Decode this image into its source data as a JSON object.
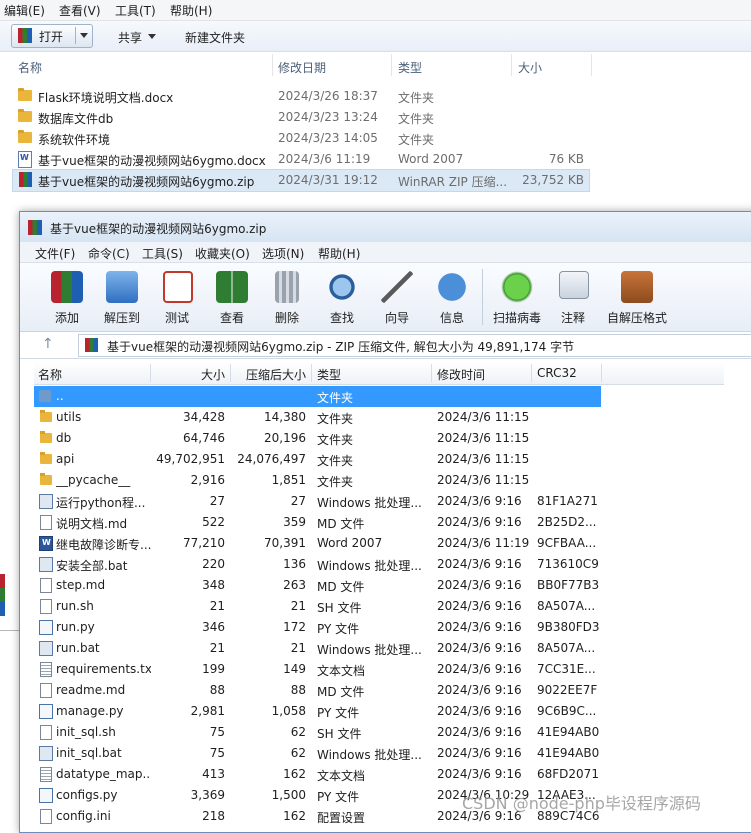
{
  "explorer": {
    "menu": [
      "编辑(E)",
      "查看(V)",
      "工具(T)",
      "帮助(H)"
    ],
    "toolbar": {
      "open": "打开",
      "share": "共享",
      "new_folder": "新建文件夹"
    },
    "columns": {
      "name": "名称",
      "date": "修改日期",
      "type": "类型",
      "size": "大小"
    },
    "files": [
      {
        "icon": "folder-icon",
        "name": "Flask环境说明文档.docx",
        "date": "2024/3/26 18:37",
        "type": "文件夹",
        "size": ""
      },
      {
        "icon": "folder-icon",
        "name": "数据库文件db",
        "date": "2024/3/23 13:24",
        "type": "文件夹",
        "size": ""
      },
      {
        "icon": "folder-icon",
        "name": "系统软件环境",
        "date": "2024/3/23 14:05",
        "type": "文件夹",
        "size": ""
      },
      {
        "icon": "word-doc-icon",
        "name": "基于vue框架的动漫视频网站6ygmo.docx",
        "date": "2024/3/6 11:19",
        "type": "Word 2007",
        "size": "76 KB"
      },
      {
        "icon": "winrar-icon",
        "name": "基于vue框架的动漫视频网站6ygmo.zip",
        "date": "2024/3/31 19:12",
        "type": "WinRAR ZIP 压缩...",
        "size": "23,752 KB",
        "selected": true
      }
    ]
  },
  "winrar": {
    "title": "基于vue框架的动漫视频网站6ygmo.zip",
    "menu": [
      "文件(F)",
      "命令(C)",
      "工具(S)",
      "收藏夹(O)",
      "选项(N)",
      "帮助(H)"
    ],
    "tools": [
      {
        "label": "添加",
        "icon": "add-icon"
      },
      {
        "label": "解压到",
        "icon": "extract-to-icon"
      },
      {
        "label": "测试",
        "icon": "test-icon"
      },
      {
        "label": "查看",
        "icon": "view-icon"
      },
      {
        "label": "删除",
        "icon": "delete-icon"
      },
      {
        "label": "查找",
        "icon": "find-icon"
      },
      {
        "label": "向导",
        "icon": "wizard-icon"
      },
      {
        "label": "信息",
        "icon": "info-icon"
      },
      {
        "label": "扫描病毒",
        "icon": "virus-scan-icon"
      },
      {
        "label": "注释",
        "icon": "comment-icon"
      },
      {
        "label": "自解压格式",
        "icon": "sfx-icon"
      }
    ],
    "path": "基于vue框架的动漫视频网站6ygmo.zip - ZIP 压缩文件, 解包大小为 49,891,174 字节",
    "columns": {
      "name": "名称",
      "size": "大小",
      "packed": "压缩后大小",
      "type": "类型",
      "modified": "修改时间",
      "crc": "CRC32"
    },
    "rows": [
      {
        "icon": "up",
        "name": "..",
        "size": "",
        "packed": "",
        "type": "文件夹",
        "modified": "",
        "crc": ""
      },
      {
        "icon": "folder",
        "name": "utils",
        "size": "34,428",
        "packed": "14,380",
        "type": "文件夹",
        "modified": "2024/3/6 11:15",
        "crc": ""
      },
      {
        "icon": "folder",
        "name": "db",
        "size": "64,746",
        "packed": "20,196",
        "type": "文件夹",
        "modified": "2024/3/6 11:15",
        "crc": ""
      },
      {
        "icon": "folder",
        "name": "api",
        "size": "49,702,951",
        "packed": "24,076,497",
        "type": "文件夹",
        "modified": "2024/3/6 11:15",
        "crc": ""
      },
      {
        "icon": "folder",
        "name": "__pycache__",
        "size": "2,916",
        "packed": "1,851",
        "type": "文件夹",
        "modified": "2024/3/6 11:15",
        "crc": ""
      },
      {
        "icon": "bat",
        "name": "运行python程...",
        "size": "27",
        "packed": "27",
        "type": "Windows 批处理...",
        "modified": "2024/3/6 9:16",
        "crc": "81F1A271"
      },
      {
        "icon": "doc",
        "name": "说明文档.md",
        "size": "522",
        "packed": "359",
        "type": "MD 文件",
        "modified": "2024/3/6 9:16",
        "crc": "2B25D2..."
      },
      {
        "icon": "word",
        "name": "继电故障诊断专...",
        "size": "77,210",
        "packed": "70,391",
        "type": "Word 2007",
        "modified": "2024/3/6 11:19",
        "crc": "9CFBAA..."
      },
      {
        "icon": "bat",
        "name": "安装全部.bat",
        "size": "220",
        "packed": "136",
        "type": "Windows 批处理...",
        "modified": "2024/3/6 9:16",
        "crc": "713610C9"
      },
      {
        "icon": "doc",
        "name": "step.md",
        "size": "348",
        "packed": "263",
        "type": "MD 文件",
        "modified": "2024/3/6 9:16",
        "crc": "BB0F77B3"
      },
      {
        "icon": "doc",
        "name": "run.sh",
        "size": "21",
        "packed": "21",
        "type": "SH 文件",
        "modified": "2024/3/6 9:16",
        "crc": "8A507A..."
      },
      {
        "icon": "py",
        "name": "run.py",
        "size": "346",
        "packed": "172",
        "type": "PY 文件",
        "modified": "2024/3/6 9:16",
        "crc": "9B380FD3"
      },
      {
        "icon": "bat",
        "name": "run.bat",
        "size": "21",
        "packed": "21",
        "type": "Windows 批处理...",
        "modified": "2024/3/6 9:16",
        "crc": "8A507A..."
      },
      {
        "icon": "txt",
        "name": "requirements.txt",
        "size": "199",
        "packed": "149",
        "type": "文本文档",
        "modified": "2024/3/6 9:16",
        "crc": "7CC31E..."
      },
      {
        "icon": "doc",
        "name": "readme.md",
        "size": "88",
        "packed": "88",
        "type": "MD 文件",
        "modified": "2024/3/6 9:16",
        "crc": "9022EE7F"
      },
      {
        "icon": "py",
        "name": "manage.py",
        "size": "2,981",
        "packed": "1,058",
        "type": "PY 文件",
        "modified": "2024/3/6 9:16",
        "crc": "9C6B9C..."
      },
      {
        "icon": "doc",
        "name": "init_sql.sh",
        "size": "75",
        "packed": "62",
        "type": "SH 文件",
        "modified": "2024/3/6 9:16",
        "crc": "41E94AB0"
      },
      {
        "icon": "bat",
        "name": "init_sql.bat",
        "size": "75",
        "packed": "62",
        "type": "Windows 批处理...",
        "modified": "2024/3/6 9:16",
        "crc": "41E94AB0"
      },
      {
        "icon": "txt",
        "name": "datatype_map....",
        "size": "413",
        "packed": "162",
        "type": "文本文档",
        "modified": "2024/3/6 9:16",
        "crc": "68FD2071"
      },
      {
        "icon": "py",
        "name": "configs.py",
        "size": "3,369",
        "packed": "1,500",
        "type": "PY 文件",
        "modified": "2024/3/6 10:29",
        "crc": "12AAE3..."
      },
      {
        "icon": "doc",
        "name": "config.ini",
        "size": "218",
        "packed": "162",
        "type": "配置设置",
        "modified": "2024/3/6 9:16",
        "crc": "889C74C6"
      }
    ]
  },
  "watermark": "CSDN @node-php毕设程序源码"
}
